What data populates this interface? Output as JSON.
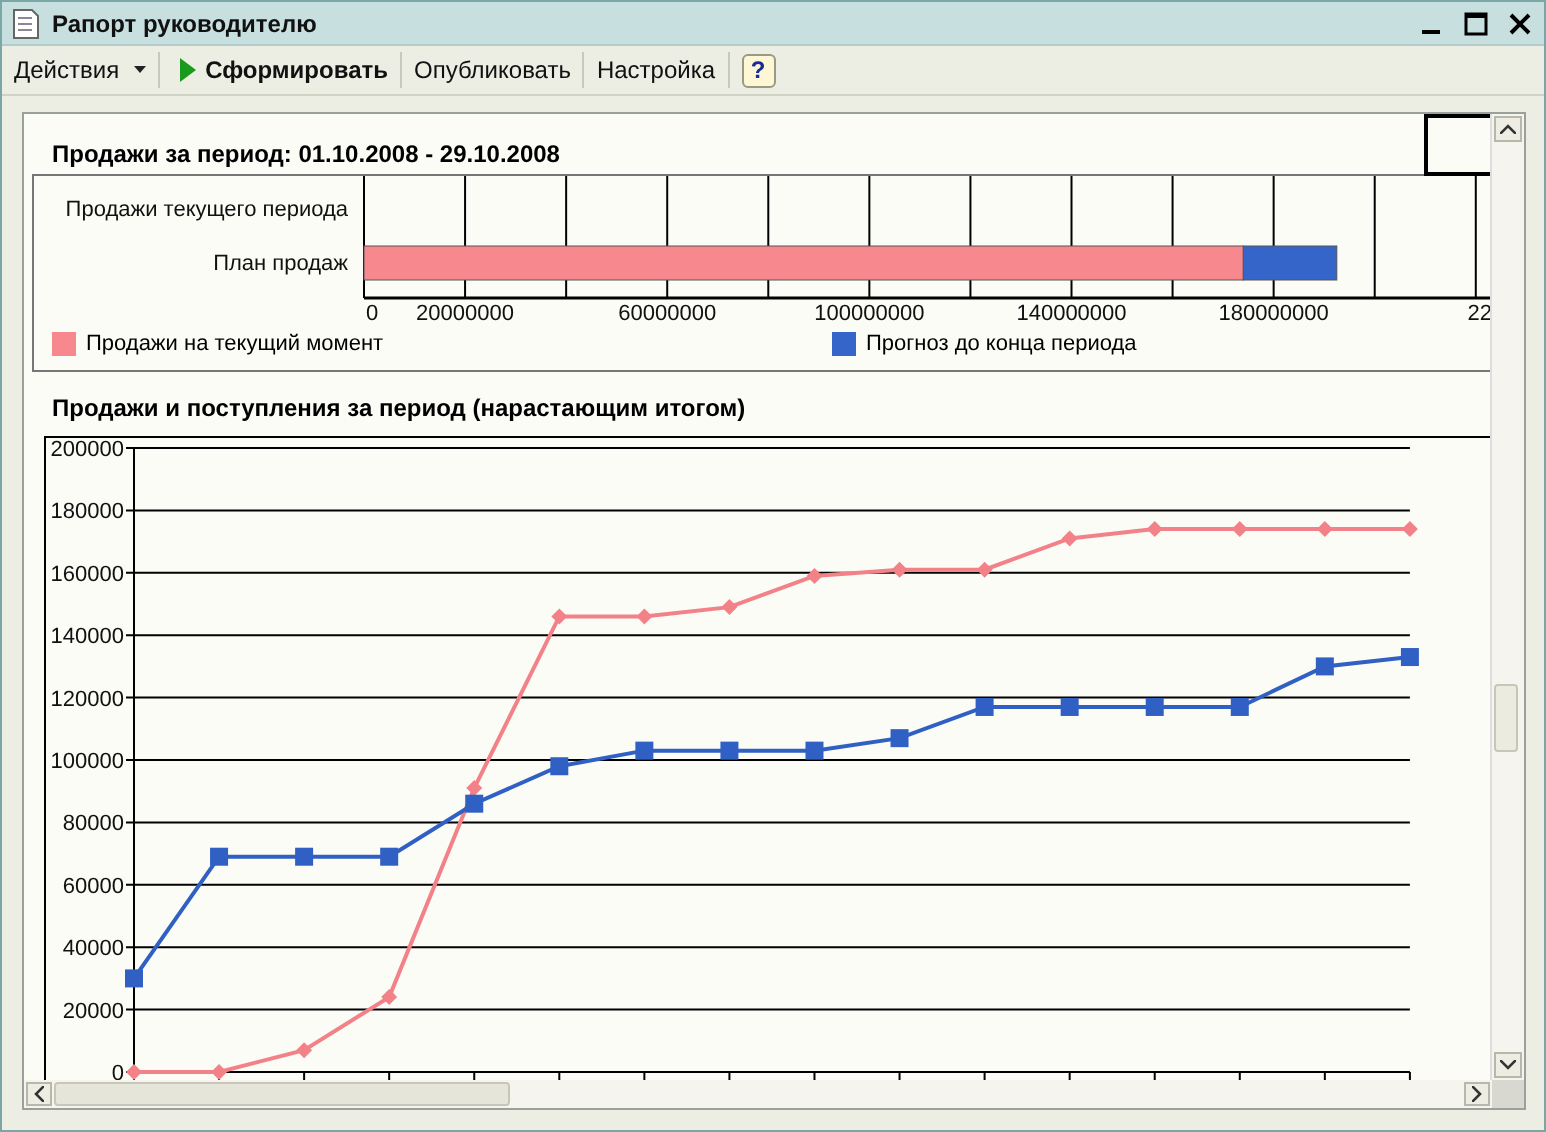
{
  "window": {
    "title": "Рапорт руководителю"
  },
  "toolbar": {
    "actions_menu": "Действия",
    "buttons": [
      {
        "label": "Сформировать",
        "kind": "run"
      },
      {
        "label": "Опубликовать",
        "kind": "plain"
      },
      {
        "label": "Настройка",
        "kind": "plain"
      }
    ],
    "help": "?"
  },
  "report": {
    "title": "Продажи за период: 01.10.2008 - 29.10.2008",
    "sales_chart": {
      "chart_data": {
        "type": "bar",
        "orientation": "horizontal",
        "stacked": true,
        "categories": [
          "Продажи текущего периода",
          "План продаж"
        ],
        "series": [
          {
            "name": "Продажи на текущий момент",
            "color": "#f7888d",
            "values": [
              null,
              174000000
            ]
          },
          {
            "name": "Прогноз до конца периода",
            "color": "#3565c8",
            "values": [
              null,
              18500000
            ]
          }
        ],
        "xlim": [
          0,
          224000000
        ],
        "grid": true,
        "xticks": [
          0,
          20000000,
          60000000,
          100000000,
          140000000,
          180000000
        ]
      },
      "cut_axis_label": "22"
    },
    "cumulative_chart": {
      "chart_data": {
        "type": "line",
        "title": "Продажи и поступления за период (нарастающим итогом)",
        "ylim": [
          0,
          200000
        ],
        "grid": true,
        "yticks": [
          0,
          20000,
          40000,
          60000,
          80000,
          100000,
          120000,
          140000,
          160000,
          180000,
          200000
        ],
        "series": [
          {
            "color": "#f28288",
            "marker": "diamond",
            "values": [
              0,
              0,
              7000,
              24000,
              91000,
              146000,
              146000,
              149000,
              159000,
              161000,
              161000,
              171000,
              174000,
              174000,
              174000,
              174000
            ]
          },
          {
            "color": "#3060c4",
            "marker": "square",
            "values": [
              30000,
              69000,
              69000,
              69000,
              86000,
              98000,
              103000,
              103000,
              103000,
              107000,
              117000,
              117000,
              117000,
              117000,
              130000,
              133000
            ]
          }
        ]
      }
    }
  }
}
